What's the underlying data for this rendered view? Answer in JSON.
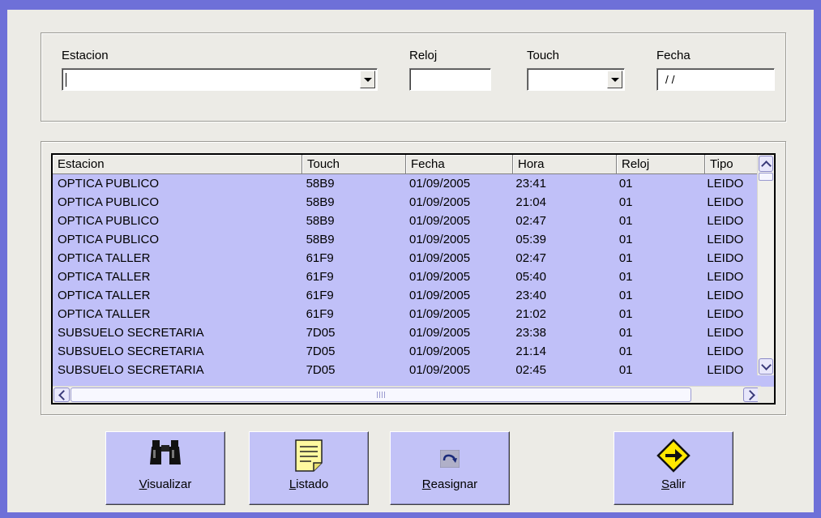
{
  "filters": {
    "estacion": {
      "label": "Estacion",
      "value": ""
    },
    "reloj": {
      "label": "Reloj",
      "value": ""
    },
    "touch": {
      "label": "Touch",
      "value": ""
    },
    "fecha": {
      "label": "Fecha",
      "value": " / /"
    }
  },
  "grid": {
    "columns": [
      "Estacion",
      "Touch",
      "Fecha",
      "Hora",
      "Reloj",
      "Tipo"
    ],
    "rows": [
      [
        "OPTICA PUBLICO",
        "58B9",
        "01/09/2005",
        "23:41",
        "01",
        "LEIDO"
      ],
      [
        "OPTICA PUBLICO",
        "58B9",
        "01/09/2005",
        "21:04",
        "01",
        "LEIDO"
      ],
      [
        "OPTICA PUBLICO",
        "58B9",
        "01/09/2005",
        "02:47",
        "01",
        "LEIDO"
      ],
      [
        "OPTICA PUBLICO",
        "58B9",
        "01/09/2005",
        "05:39",
        "01",
        "LEIDO"
      ],
      [
        "OPTICA TALLER",
        "61F9",
        "01/09/2005",
        "02:47",
        "01",
        "LEIDO"
      ],
      [
        "OPTICA TALLER",
        "61F9",
        "01/09/2005",
        "05:40",
        "01",
        "LEIDO"
      ],
      [
        "OPTICA TALLER",
        "61F9",
        "01/09/2005",
        "23:40",
        "01",
        "LEIDO"
      ],
      [
        "OPTICA TALLER",
        "61F9",
        "01/09/2005",
        "21:02",
        "01",
        "LEIDO"
      ],
      [
        "SUBSUELO SECRETARIA",
        "7D05",
        "01/09/2005",
        "23:38",
        "01",
        "LEIDO"
      ],
      [
        "SUBSUELO SECRETARIA",
        "7D05",
        "01/09/2005",
        "21:14",
        "01",
        "LEIDO"
      ],
      [
        "SUBSUELO SECRETARIA",
        "7D05",
        "01/09/2005",
        "02:45",
        "01",
        "LEIDO"
      ]
    ]
  },
  "buttons": {
    "visualizar": {
      "hotkey": "V",
      "rest": "isualizar",
      "icon": "binoculars-icon"
    },
    "listado": {
      "hotkey": "L",
      "rest": "istado",
      "icon": "notepad-icon"
    },
    "reasignar": {
      "hotkey": "R",
      "rest": "easignar",
      "icon": "redo-arrow-icon"
    },
    "salir": {
      "hotkey": "S",
      "rest": "alir",
      "icon": "exit-sign-icon"
    }
  },
  "colors": {
    "selection": "#c0c0f8",
    "button": "#c2c2f7",
    "frame": "#6e70d8"
  }
}
